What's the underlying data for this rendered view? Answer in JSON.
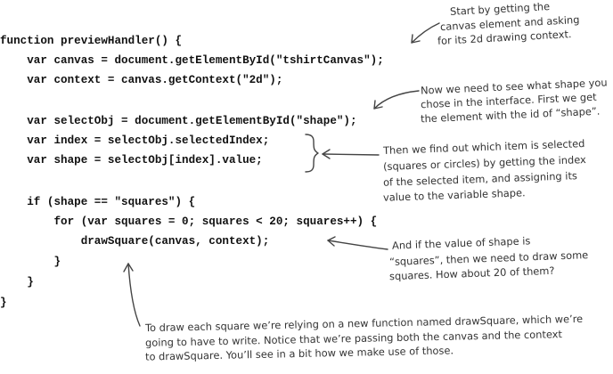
{
  "code_lines": [
    "function previewHandler() {",
    "    var canvas = document.getElementById(\"tshirtCanvas\");",
    "    var context = canvas.getContext(\"2d\");",
    "",
    "    var selectObj = document.getElementById(\"shape\");",
    "    var index = selectObj.selectedIndex;",
    "    var shape = selectObj[index].value;",
    "",
    "    if (shape == \"squares\") {",
    "        for (var squares = 0; squares < 20; squares++) {",
    "            drawSquare(canvas, context);",
    "        }",
    "    }",
    "}"
  ],
  "annotations": {
    "canvas_note": [
      "Start by getting the",
      "canvas element and asking",
      "for its 2d drawing context."
    ],
    "shape_note": [
      "Now we need to see what shape you",
      "chose in the interface. First we get",
      "the element with the id of “shape”."
    ],
    "index_note": [
      "Then we find out which item is selected",
      "(squares or circles) by getting the index",
      "of the selected item, and assigning its",
      "value to the variable shape."
    ],
    "squares_note": [
      "And if the value of shape is",
      "“squares”, then we need to draw some",
      "squares. How about 20 of them?"
    ],
    "drawsquare_note": [
      "To draw each square we’re relying on a new function named drawSquare, which we’re",
      "going to have to write. Notice that we’re passing both the canvas and the context",
      "to drawSquare. You’ll see in a bit how we make use of those."
    ]
  }
}
